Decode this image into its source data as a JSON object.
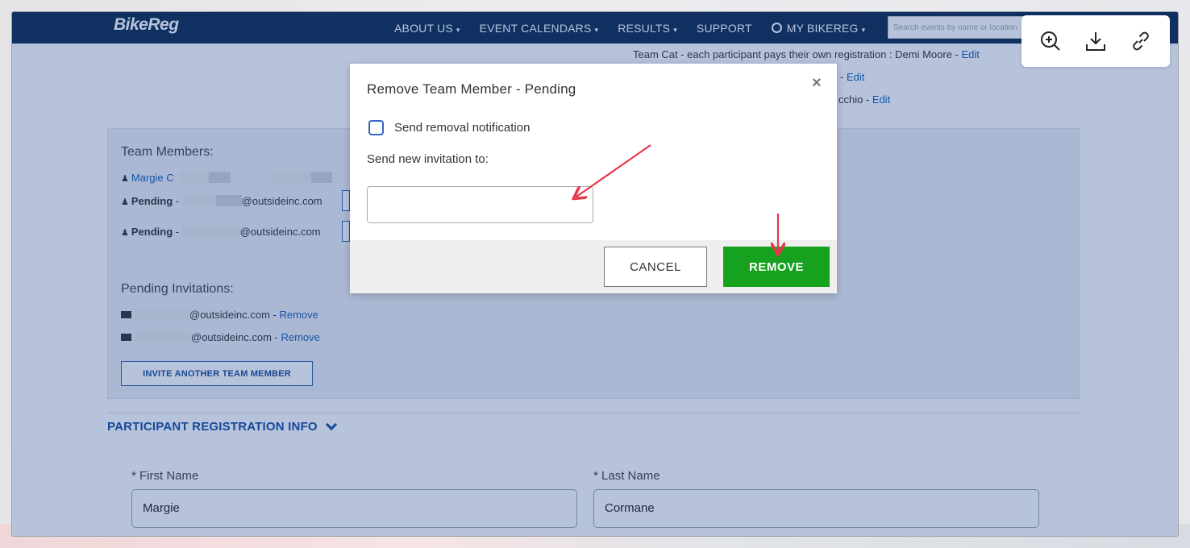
{
  "site": {
    "logo": "BikeReg",
    "nav": [
      {
        "label": "ABOUT US",
        "caret": "▾"
      },
      {
        "label": "EVENT CALENDARS",
        "caret": "▾"
      },
      {
        "label": "RESULTS",
        "caret": "▾"
      },
      {
        "label": "SUPPORT",
        "caret": ""
      },
      {
        "label": "MY BIKEREG",
        "caret": "▾"
      }
    ],
    "search_placeholder": "Search events by name or location"
  },
  "team_lines": [
    {
      "text": "Team Cat - each participant pays their own registration : Demi Moore - ",
      "link": "Edit"
    },
    {
      "text": "- ",
      "link": "Edit"
    },
    {
      "text": "cchio - ",
      "link": "Edit"
    }
  ],
  "team_panel": {
    "members_heading": "Team Members:",
    "members": [
      {
        "name": "Margie C",
        "status": "",
        "email": ""
      },
      {
        "name": "",
        "status": "Pending",
        "email": "@outsideinc.com"
      },
      {
        "name": "",
        "status": "Pending",
        "email": "@outsideinc.com"
      }
    ],
    "pending_heading": "Pending Invitations:",
    "pending": [
      {
        "email": "@outsideinc.com",
        "action": "Remove"
      },
      {
        "email": "@outsideinc.com",
        "action": "Remove"
      }
    ],
    "invite_button": "INVITE ANOTHER TEAM MEMBER"
  },
  "registration": {
    "section_title": "PARTICIPANT REGISTRATION INFO",
    "first_name_label": "* First Name",
    "first_name_value": "Margie",
    "last_name_label": "* Last Name",
    "last_name_value": "Cormane"
  },
  "modal": {
    "title": "Remove Team Member - Pending",
    "close": "×",
    "checkbox_label": "Send removal notification",
    "checkbox_checked": false,
    "invite_label": "Send new invitation to:",
    "invite_value": "",
    "cancel_label": "CANCEL",
    "remove_label": "REMOVE",
    "remove_color": "#16a21e"
  },
  "toolbar": {
    "icons": [
      "zoom-in-icon",
      "download-icon",
      "link-icon"
    ]
  },
  "colors": {
    "navbar": "#0e2a4e",
    "link": "#1a5fb4",
    "annotation": "#e8364a"
  }
}
